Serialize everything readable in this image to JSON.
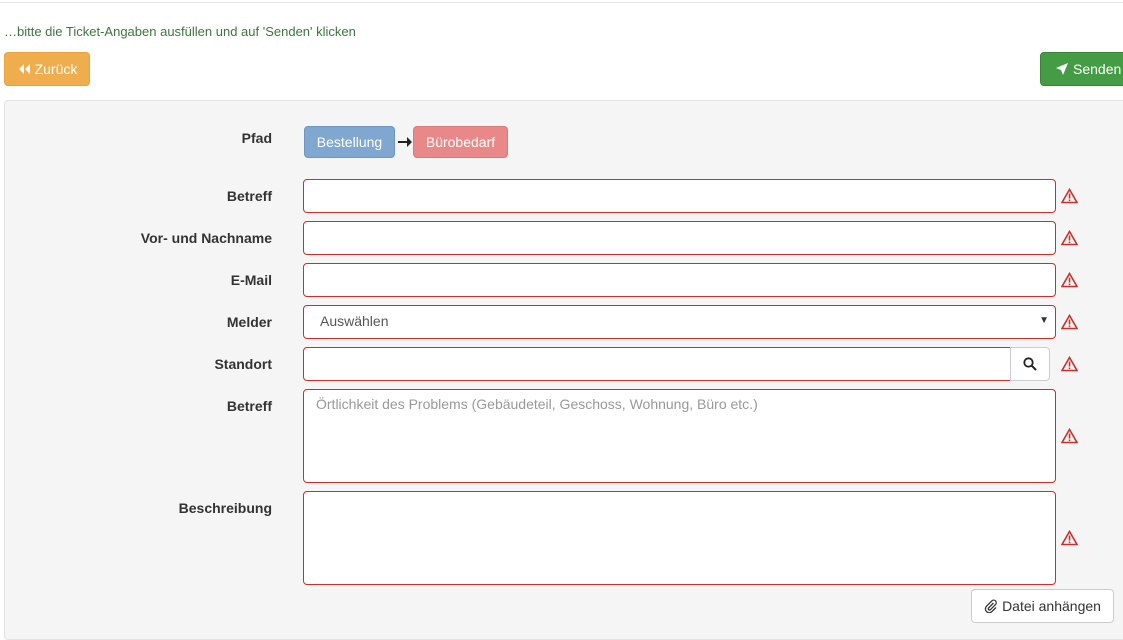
{
  "instruction": "…bitte die Ticket-Angaben ausfüllen und auf 'Senden' klicken",
  "buttons": {
    "back": "Zurück",
    "send": "Senden",
    "attach": "Datei anhängen"
  },
  "form": {
    "path_label": "Pfad",
    "path": [
      "Bestellung",
      "Bürobedarf"
    ],
    "subject_label": "Betreff",
    "name_label": "Vor- und Nachname",
    "email_label": "E-Mail",
    "reporter_label": "Melder",
    "reporter_value": "Auswählen",
    "location_label": "Standort",
    "location_detail_label": "Betreff",
    "location_detail_placeholder": "Örtlichkeit des Problems (Gebäudeteil, Geschoss, Wohnung, Büro etc.)",
    "description_label": "Beschreibung"
  },
  "colors": {
    "back": "#f0ad4e",
    "send": "#449d44",
    "path_1": "#7fa7d0",
    "path_2": "#e98888",
    "error": "#c9302c",
    "instruction": "#3c763d"
  },
  "icons": {
    "back": "double-chevron-left-icon",
    "send": "paper-plane-icon",
    "path_separator": "arrow-right-icon",
    "search": "search-icon",
    "warning": "warning-triangle-icon",
    "attach": "paperclip-icon"
  }
}
